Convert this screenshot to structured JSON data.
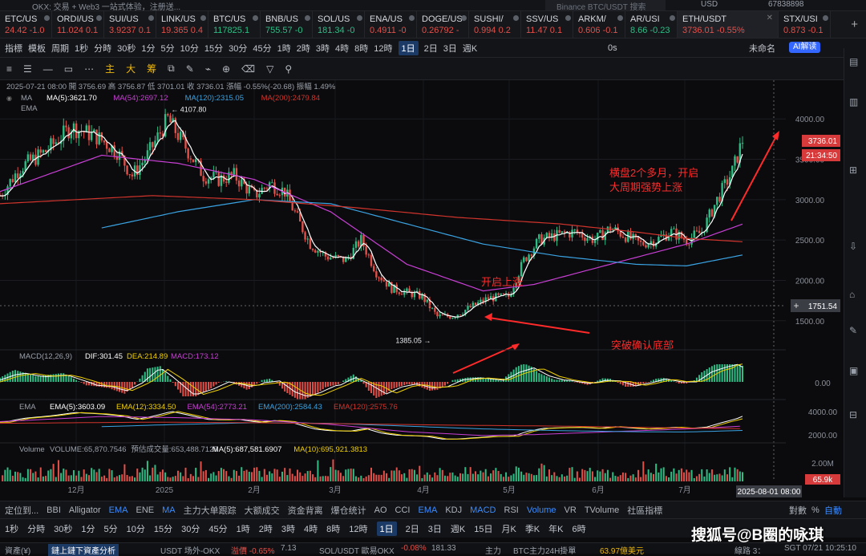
{
  "topbar": {
    "tab_text": "OKX: 交易 + Web3 一站式体验，注册送...",
    "search_text": "Binance BTC/USDT 搜索",
    "currency": "USD",
    "account": "67838898"
  },
  "tickers": [
    {
      "name": "ETC/US",
      "value": "24.42 -1.0",
      "up": false
    },
    {
      "name": "ORDI/US",
      "value": "11.024 0.1",
      "up": false
    },
    {
      "name": "SUI/US",
      "value": "3.9237 0.1",
      "up": false
    },
    {
      "name": "LINK/US",
      "value": "19.365 0.4",
      "up": false
    },
    {
      "name": "BTC/US",
      "value": "117825.1",
      "up": true
    },
    {
      "name": "BNB/US",
      "value": "755.57 -0",
      "up": true
    },
    {
      "name": "SOL/US",
      "value": "181.34 -0",
      "up": true
    },
    {
      "name": "ENA/US",
      "value": "0.4911 -0",
      "up": false
    },
    {
      "name": "DOGE/US",
      "value": "0.26792 -",
      "up": false
    },
    {
      "name": "SUSHI/",
      "value": "0.994 0.2",
      "up": false
    },
    {
      "name": "SSV/US",
      "value": "11.47 0.1",
      "up": false
    },
    {
      "name": "ARKM/",
      "value": "0.606 -0.1",
      "up": false
    },
    {
      "name": "AR/USI",
      "value": "8.66 -0.23",
      "up": true
    },
    {
      "name": "ETH/USDT",
      "value": "3736.01 -0.55%",
      "up": false,
      "active": true
    },
    {
      "name": "STX/USI",
      "value": "0.873 -0.1",
      "up": false
    }
  ],
  "toolbar1": {
    "items": [
      "指標",
      "模板",
      "周期",
      "1秒",
      "分時",
      "30秒",
      "1分",
      "5分",
      "10分",
      "15分",
      "30分",
      "45分",
      "1時",
      "2時",
      "3時",
      "4時",
      "8時",
      "12時",
      "1日",
      "2日",
      "3日",
      "週K"
    ],
    "selected": "1日",
    "right_items": [
      "0s",
      "未命名"
    ],
    "ai_label": "AI解读"
  },
  "toolbar2": {
    "tools": [
      "≡",
      "☰",
      "—",
      "▭",
      "⋯",
      "主",
      "大",
      "筹",
      "⧉",
      "✎",
      "⌁",
      "⊕",
      "⌫",
      "▽",
      "⚲"
    ]
  },
  "info": {
    "ohlc_line": "2025-07-21 08:00  開 3756.69  高 3756.87  低 3701.01  收 3736.01  漲幅 -0.55%(-20.68)  振幅 1.49%",
    "ma_line": [
      "MA",
      "MA(5):3621.70",
      "MA(54):2697.12",
      "MA(120):2315.05",
      "MA(200):2479.84"
    ],
    "ema_line": "EMA"
  },
  "annotations": {
    "high_label": "4107.80",
    "low_label": "1385.05",
    "text_rise": "开启上涨",
    "text_bottom": "突破确认底部",
    "text_consolidate_1": "横盘2个多月，开启",
    "text_consolidate_2": "大周期强势上涨",
    "price_tag": "3736.01",
    "timer_tag": "21:34:50",
    "crosshair_tag": "1751.54",
    "date_tag": "2025-08-01 08:00"
  },
  "panels": {
    "macd": {
      "label": "MACD(12,26,9)",
      "dif": "DIF:301.45",
      "dea": "DEA:214.89",
      "macd": "MACD:173.12",
      "zero": "0.00"
    },
    "ema": {
      "label": "EMA",
      "items": [
        "EMA(5):3603.09",
        "EMA(12):3334.50",
        "EMA(54):2773.21",
        "EMA(200):2584.43",
        "EMA(120):2575.76"
      ],
      "ticks": [
        "4000.00",
        "2000.00"
      ]
    },
    "volume": {
      "label": "Volume",
      "items": [
        "VOLUME:65,870.7546",
        "預估成交量:653,488.7125",
        "MA(5):687,581.6907",
        "MA(10):695,921.3813"
      ],
      "ticks": [
        "2.00M",
        "65.9k"
      ]
    }
  },
  "colors": {
    "up": "#2ebd85",
    "down": "#e2504a",
    "ma5": "#ffffff",
    "ma54": "#c83fd4",
    "ma120": "#3aa3e3",
    "ma200": "#d0342c",
    "annot": "#ff2a2a"
  },
  "chart_data": {
    "type": "candlestick",
    "title": "ETH/USDT 1日",
    "x_ticks": [
      "12月",
      "2025",
      "2月",
      "3月",
      "4月",
      "5月",
      "6月",
      "7月"
    ],
    "y_ticks": [
      4000,
      3500,
      3000,
      2500,
      2000,
      1500
    ],
    "ylim": [
      1200,
      4300
    ],
    "high": {
      "label": "4107.80",
      "value": 4107.8
    },
    "low": {
      "label": "1385.05",
      "value": 1385.05
    },
    "last_price": 3736.01,
    "close_path": [
      [
        0,
        3050
      ],
      [
        8,
        3400
      ],
      [
        18,
        3600
      ],
      [
        28,
        3900
      ],
      [
        38,
        3780
      ],
      [
        46,
        3600
      ],
      [
        52,
        3300
      ],
      [
        58,
        3550
      ],
      [
        66,
        4000
      ],
      [
        72,
        3700
      ],
      [
        80,
        3300
      ],
      [
        86,
        3250
      ],
      [
        92,
        3300
      ],
      [
        100,
        3050
      ],
      [
        106,
        3200
      ],
      [
        112,
        3100
      ],
      [
        118,
        2700
      ],
      [
        122,
        2450
      ],
      [
        128,
        2300
      ],
      [
        136,
        2250
      ],
      [
        142,
        2500
      ],
      [
        148,
        2100
      ],
      [
        154,
        1900
      ],
      [
        160,
        1850
      ],
      [
        166,
        1800
      ],
      [
        172,
        1550
      ],
      [
        178,
        1560
      ],
      [
        184,
        1650
      ],
      [
        192,
        1780
      ],
      [
        200,
        1800
      ],
      [
        206,
        2250
      ],
      [
        212,
        2500
      ],
      [
        218,
        2550
      ],
      [
        226,
        2600
      ],
      [
        234,
        2500
      ],
      [
        240,
        2650
      ],
      [
        246,
        2550
      ],
      [
        252,
        2450
      ],
      [
        258,
        2500
      ],
      [
        264,
        2600
      ],
      [
        270,
        2500
      ],
      [
        276,
        2600
      ],
      [
        282,
        3000
      ],
      [
        288,
        3350
      ],
      [
        292,
        3736
      ]
    ],
    "x_domain": [
      0,
      292
    ],
    "series": [
      {
        "name": "MA(5)",
        "color": "#ffffff"
      },
      {
        "name": "MA(54)",
        "color": "#c83fd4",
        "path": [
          [
            0,
            3100
          ],
          [
            40,
            3550
          ],
          [
            70,
            3450
          ],
          [
            100,
            3250
          ],
          [
            130,
            2850
          ],
          [
            160,
            2200
          ],
          [
            190,
            1870
          ],
          [
            210,
            1950
          ],
          [
            240,
            2200
          ],
          [
            270,
            2450
          ],
          [
            292,
            2697
          ]
        ]
      },
      {
        "name": "MA(120)",
        "color": "#3aa3e3",
        "path": [
          [
            40,
            2650
          ],
          [
            70,
            2850
          ],
          [
            100,
            3000
          ],
          [
            130,
            2950
          ],
          [
            160,
            2700
          ],
          [
            190,
            2450
          ],
          [
            220,
            2300
          ],
          [
            250,
            2200
          ],
          [
            270,
            2180
          ],
          [
            292,
            2315
          ]
        ]
      },
      {
        "name": "MA(200)",
        "color": "#d0342c",
        "path": [
          [
            0,
            2950
          ],
          [
            60,
            3050
          ],
          [
            100,
            3000
          ],
          [
            140,
            2900
          ],
          [
            180,
            2780
          ],
          [
            220,
            2700
          ],
          [
            250,
            2600
          ],
          [
            270,
            2520
          ],
          [
            292,
            2479
          ]
        ]
      }
    ]
  },
  "bottom1": {
    "items": [
      "定位到...",
      "BBI",
      "Alligator",
      "EMA",
      "ENE",
      "MA",
      "主力大单跟踪",
      "大额成交",
      "资金背离",
      "爆仓统计",
      "AO",
      "CCI",
      "EMA",
      "KDJ",
      "MACD",
      "RSI",
      "Volume",
      "VR",
      "TVolume",
      "社區指標",
      "對數",
      "%",
      "自動"
    ],
    "active": [
      "EMA",
      "MA",
      "EMA",
      "MACD",
      "Volume",
      "自動"
    ]
  },
  "bottom2": {
    "items": [
      "1秒",
      "分時",
      "30秒",
      "1分",
      "5分",
      "10分",
      "15分",
      "30分",
      "45分",
      "1時",
      "2時",
      "3時",
      "4時",
      "8時",
      "12時",
      "1日",
      "2日",
      "3日",
      "週K",
      "15日",
      "月K",
      "季K",
      "年K",
      "6時"
    ],
    "selected": "1日"
  },
  "watermark": "搜狐号@B圈的咏琪",
  "statusbar": {
    "left": "資產(¥)",
    "mid": "鏈上鏈下資產分析",
    "usdt": "USDT 场外-OKX",
    "usdt_chg": "溢價 -0.65%",
    "usdt_val": "7.13",
    "sol": "SOL/USDT 歐易OKX",
    "sol_chg": "-0.08%",
    "sol_val": "181.33",
    "main": "主力",
    "btc": "BTC主力24H掛單",
    "btc_val": "63.97億美元",
    "right": "線路 3：",
    "time": "SGT 07/21 10:25:10"
  }
}
